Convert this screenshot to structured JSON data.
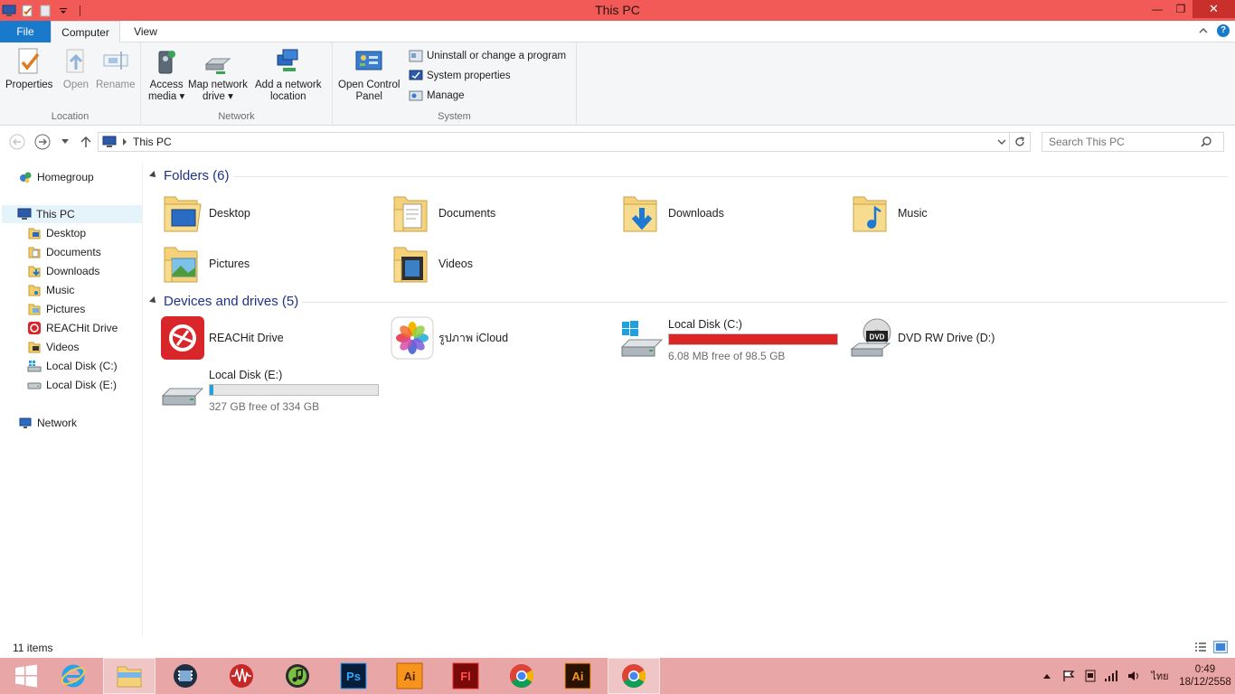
{
  "window": {
    "title": "This PC",
    "minimize": "—",
    "restore": "❐",
    "close": "✕"
  },
  "ribbon_tabs": {
    "file": "File",
    "computer": "Computer",
    "view": "View"
  },
  "ribbon": {
    "location": {
      "label": "Location",
      "properties": "Properties",
      "open": "Open",
      "rename": "Rename"
    },
    "network": {
      "label": "Network",
      "access_media_1": "Access",
      "access_media_2": "media ▾",
      "map_drive_1": "Map network",
      "map_drive_2": "drive ▾",
      "add_location_1": "Add a network",
      "add_location_2": "location"
    },
    "system": {
      "label": "System",
      "open_cp_1": "Open Control",
      "open_cp_2": "Panel",
      "uninstall": "Uninstall or change a program",
      "sys_props": "System properties",
      "manage": "Manage"
    }
  },
  "address": {
    "path": "This PC",
    "search_placeholder": "Search This PC"
  },
  "navpane": {
    "homegroup": "Homegroup",
    "this_pc": "This PC",
    "items": [
      "Desktop",
      "Documents",
      "Downloads",
      "Music",
      "Pictures",
      "REACHit Drive",
      "Videos",
      "Local Disk (C:)",
      "Local Disk (E:)"
    ],
    "network": "Network"
  },
  "folders": {
    "header": "Folders (6)",
    "items": [
      "Desktop",
      "Documents",
      "Downloads",
      "Music",
      "Pictures",
      "Videos"
    ]
  },
  "devices": {
    "header": "Devices and drives (5)",
    "reachit": "REACHit Drive",
    "icloud": "รูปภาพ iCloud",
    "disk_c": {
      "name": "Local Disk (C:)",
      "free": "6.08 MB free of 98.5 GB",
      "used_fraction": 0.9999
    },
    "dvd": "DVD RW Drive (D:)",
    "disk_e": {
      "name": "Local Disk (E:)",
      "free": "327 GB free of 334 GB",
      "used_fraction": 0.021
    }
  },
  "status": {
    "count": "11 items"
  },
  "colors": {
    "titlebar": "#f25a58",
    "taskbar": "#e9a6a6",
    "accent": "#1979ca",
    "disk_full": "#da2626",
    "disk_ok": "#26a0da"
  },
  "tray": {
    "lang": "ไทย",
    "time": "0:49",
    "date": "18/12/2558"
  }
}
